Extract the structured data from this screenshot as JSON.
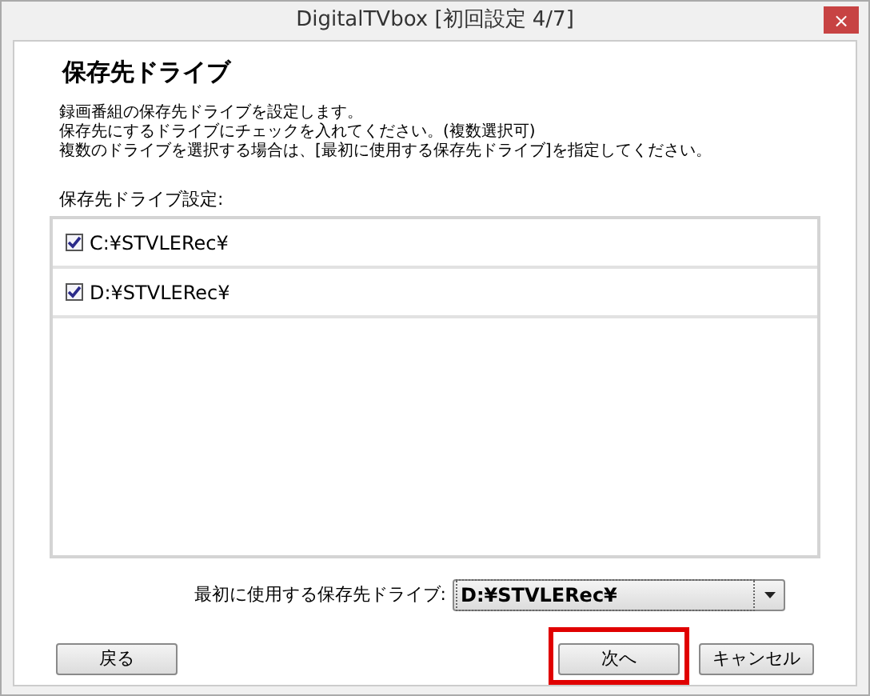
{
  "window": {
    "title": "DigitalTVbox [初回設定 4/7]",
    "close": "×"
  },
  "heading": "保存先ドライブ",
  "description": [
    "録画番組の保存先ドライブを設定します。",
    "保存先にするドライブにチェックを入れてください。(複数選択可)",
    "複数のドライブを選択する場合は、[最初に使用する保存先ドライブ]を指定してください。"
  ],
  "drive_list": {
    "label": "保存先ドライブ設定:",
    "items": [
      {
        "label": "C:¥STVLERec¥",
        "checked": true
      },
      {
        "label": "D:¥STVLERec¥",
        "checked": true
      }
    ]
  },
  "first_drive": {
    "label": "最初に使用する保存先ドライブ:",
    "value": "D:¥STVLERec¥"
  },
  "buttons": [
    {
      "label": "戻る",
      "highlighted": false
    },
    {
      "label": "次へ",
      "highlighted": true
    },
    {
      "label": "キャンセル",
      "highlighted": false
    }
  ]
}
